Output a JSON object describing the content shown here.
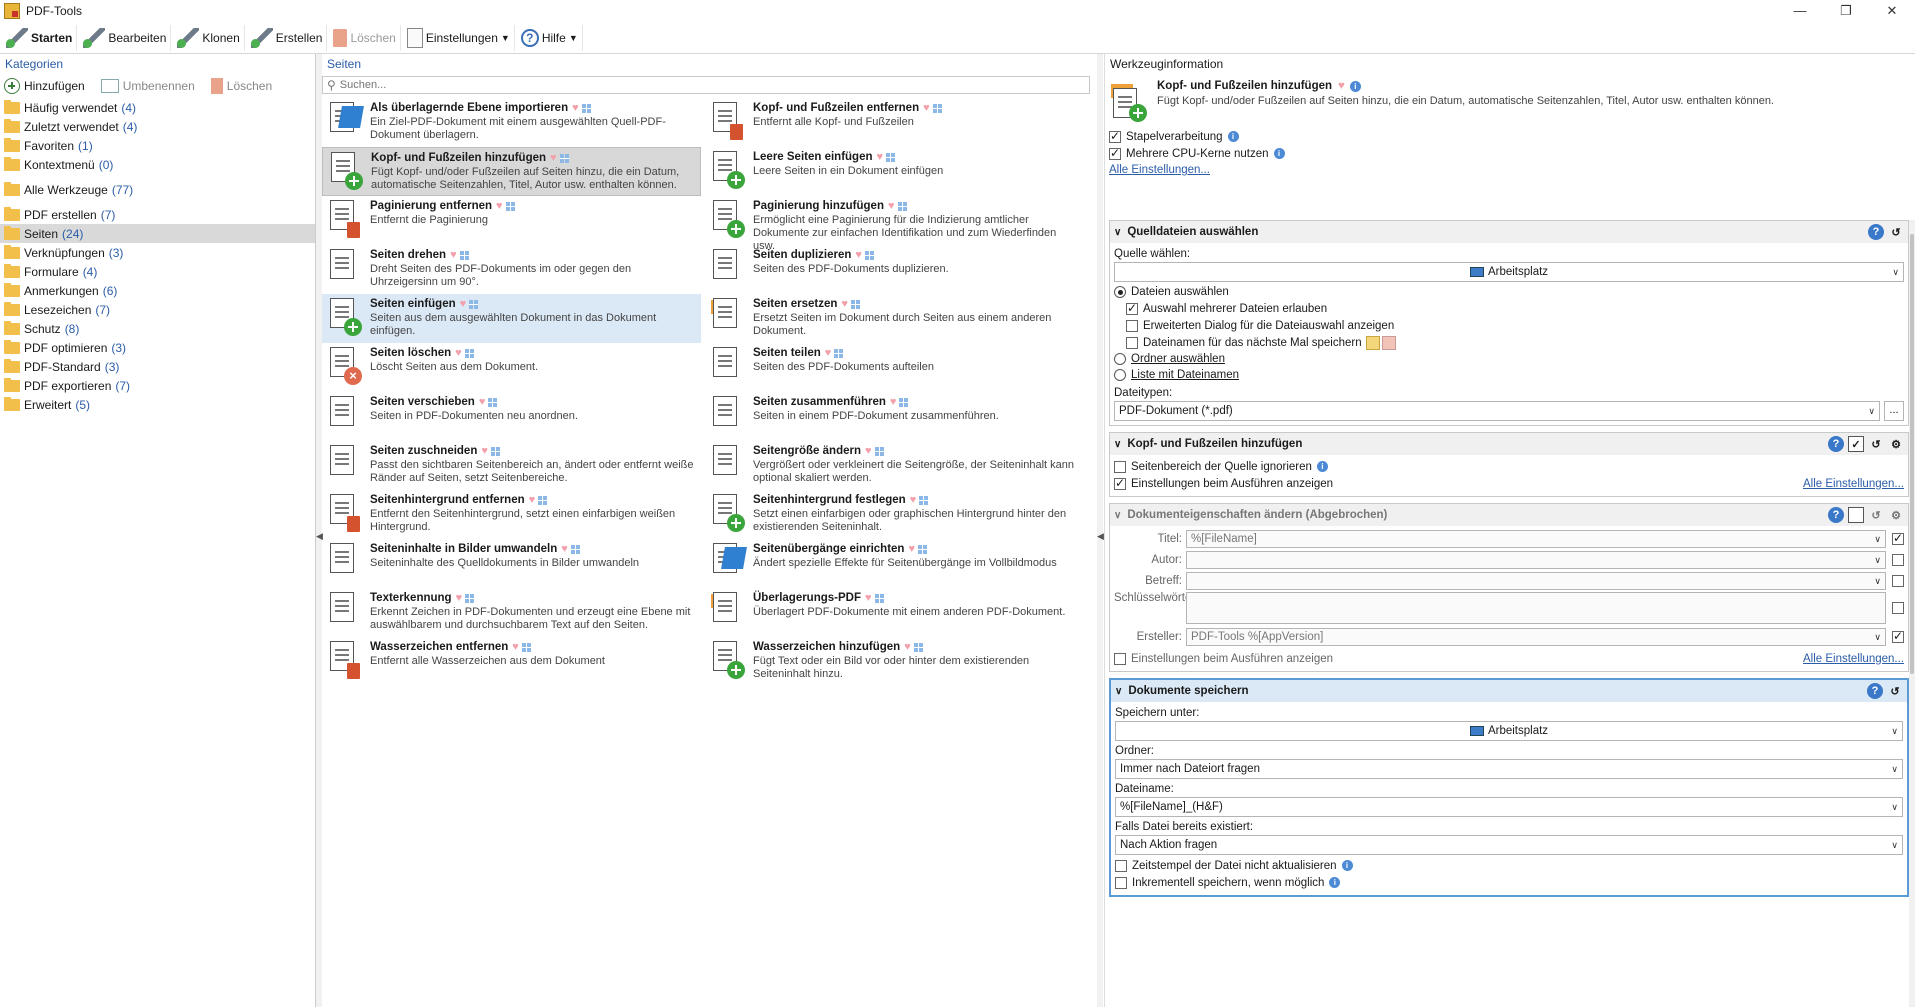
{
  "window": {
    "title": "PDF-Tools"
  },
  "toolbar": {
    "items": [
      {
        "label": "Starten",
        "bold": true,
        "disabled": false
      },
      {
        "label": "Bearbeiten",
        "disabled": false
      },
      {
        "label": "Klonen",
        "disabled": false
      },
      {
        "label": "Erstellen",
        "disabled": false
      },
      {
        "label": "Löschen",
        "disabled": true
      },
      {
        "label": "Einstellungen",
        "disabled": false,
        "dropdown": true
      },
      {
        "label": "Hilfe",
        "disabled": false,
        "dropdown": true
      }
    ]
  },
  "categories": {
    "header": "Kategorien",
    "actions": {
      "add": "Hinzufügen",
      "rename": "Umbenennen",
      "delete": "Löschen"
    },
    "items": [
      {
        "label": "Häufig verwendet",
        "count": "(4)"
      },
      {
        "label": "Zuletzt verwendet",
        "count": "(4)"
      },
      {
        "label": "Favoriten",
        "count": "(1)"
      },
      {
        "label": "Kontextmenü",
        "count": "(0)"
      },
      {
        "label": "Alle Werkzeuge",
        "count": "(77)"
      },
      {
        "label": "PDF erstellen",
        "count": "(7)"
      },
      {
        "label": "Seiten",
        "count": "(24)"
      },
      {
        "label": "Verknüpfungen",
        "count": "(3)"
      },
      {
        "label": "Formulare",
        "count": "(4)"
      },
      {
        "label": "Anmerkungen",
        "count": "(6)"
      },
      {
        "label": "Lesezeichen",
        "count": "(7)"
      },
      {
        "label": "Schutz",
        "count": "(8)"
      },
      {
        "label": "PDF optimieren",
        "count": "(3)"
      },
      {
        "label": "PDF-Standard",
        "count": "(3)"
      },
      {
        "label": "PDF exportieren",
        "count": "(7)"
      },
      {
        "label": "Erweitert",
        "count": "(5)"
      }
    ],
    "selected": "Seiten"
  },
  "pages": {
    "header": "Seiten",
    "search_placeholder": "Suchen...",
    "tools": [
      {
        "name": "Als überlagernde Ebene importieren",
        "desc": "Ein Ziel-PDF-Dokument mit einem ausgewählten Quell-PDF-Dokument überlagern.",
        "icon": "layer-import-icon"
      },
      {
        "name": "Kopf- und Fußzeilen entfernen",
        "desc": "Entfernt alle Kopf- und Fußzeilen",
        "icon": "header-footer-remove-icon"
      },
      {
        "name": "Kopf- und Fußzeilen hinzufügen",
        "desc": "Fügt Kopf- und/oder Fußzeilen auf Seiten hinzu, die ein Datum, automatische Seitenzahlen, Titel, Autor usw. enthalten können.",
        "icon": "header-footer-add-icon"
      },
      {
        "name": "Leere Seiten einfügen",
        "desc": "Leere Seiten in ein Dokument einfügen",
        "icon": "blank-page-add-icon"
      },
      {
        "name": "Paginierung entfernen",
        "desc": "Entfernt die Paginierung",
        "icon": "pagination-remove-icon"
      },
      {
        "name": "Paginierung hinzufügen",
        "desc": "Ermöglicht eine Paginierung für die Indizierung amtlicher Dokumente zur einfachen Identifikation und zum Wiederfinden usw.",
        "icon": "pagination-add-icon"
      },
      {
        "name": "Seiten drehen",
        "desc": "Dreht Seiten des PDF-Dokuments im oder gegen den Uhrzeigersinn um 90°.",
        "icon": "rotate-90-icon"
      },
      {
        "name": "Seiten duplizieren",
        "desc": "Seiten des PDF-Dokuments duplizieren.",
        "icon": "duplicate-pages-icon"
      },
      {
        "name": "Seiten einfügen",
        "desc": "Seiten aus dem ausgewählten Dokument in das Dokument einfügen.",
        "icon": "insert-pages-icon"
      },
      {
        "name": "Seiten ersetzen",
        "desc": "Ersetzt Seiten im Dokument durch Seiten aus einem anderen Dokument.",
        "icon": "replace-pages-icon"
      },
      {
        "name": "Seiten löschen",
        "desc": "Löscht Seiten aus dem Dokument.",
        "icon": "delete-pages-icon"
      },
      {
        "name": "Seiten teilen",
        "desc": "Seiten des PDF-Dokuments aufteilen",
        "icon": "split-pages-icon"
      },
      {
        "name": "Seiten verschieben",
        "desc": "Seiten in PDF-Dokumenten neu anordnen.",
        "icon": "move-pages-icon"
      },
      {
        "name": "Seiten zusammenführen",
        "desc": "Seiten in einem PDF-Dokument zusammenführen.",
        "icon": "merge-pages-icon"
      },
      {
        "name": "Seiten zuschneiden",
        "desc": "Passt den sichtbaren Seitenbereich an, ändert oder entfernt weiße Ränder auf Seiten, setzt Seitenbereiche.",
        "icon": "crop-pages-icon"
      },
      {
        "name": "Seitengröße ändern",
        "desc": "Vergrößert oder verkleinert die Seitengröße, der Seiteninhalt kann optional skaliert werden.",
        "icon": "resize-page-icon"
      },
      {
        "name": "Seitenhintergrund entfernen",
        "desc": "Entfernt den Seitenhintergrund, setzt einen einfarbigen weißen Hintergrund.",
        "icon": "background-remove-icon"
      },
      {
        "name": "Seitenhintergrund festlegen",
        "desc": "Setzt einen einfarbigen oder graphischen Hintergrund hinter den existierenden Seiteninhalt.",
        "icon": "background-set-icon"
      },
      {
        "name": "Seiteninhalte in Bilder umwandeln",
        "desc": "Seiteninhalte des Quelldokuments in Bilder umwandeln",
        "icon": "page-to-image-icon"
      },
      {
        "name": "Seitenübergänge einrichten",
        "desc": "Ändert spezielle Effekte für Seitenübergänge im Vollbildmodus",
        "icon": "page-transition-icon"
      },
      {
        "name": "Texterkennung",
        "desc": "Erkennt Zeichen in PDF-Dokumenten und erzeugt eine Ebene mit auswählbarem und durchsuchbarem Text auf den Seiten.",
        "icon": "ocr-icon"
      },
      {
        "name": "Überlagerungs-PDF",
        "desc": "Überlagert PDF-Dokumente mit einem anderen PDF-Dokument.",
        "icon": "overlay-pdf-icon"
      },
      {
        "name": "Wasserzeichen entfernen",
        "desc": "Entfernt alle Wasserzeichen aus dem Dokument",
        "icon": "watermark-remove-icon"
      },
      {
        "name": "Wasserzeichen hinzufügen",
        "desc": "Fügt Text oder ein Bild vor oder hinter dem existierenden Seiteninhalt hinzu.",
        "icon": "watermark-add-icon"
      }
    ],
    "selected_index": 2,
    "hover_index": 8
  },
  "info": {
    "header": "Werkzeuginformation",
    "tool_name": "Kopf- und Fußzeilen hinzufügen",
    "tool_desc": "Fügt Kopf- und/oder Fußzeilen auf Seiten hinzu, die ein Datum, automatische Seitenzahlen, Titel, Autor usw. enthalten können.",
    "batch": "Stapelverarbeitung",
    "multicore": "Mehrere CPU-Kerne nutzen",
    "all_settings": "Alle Einstellungen...",
    "source": {
      "title": "Quelldateien auswählen",
      "source_label": "Quelle wählen:",
      "source_value": "Arbeitsplatz",
      "opt_files": "Dateien auswählen",
      "opt_multi": "Auswahl mehrerer Dateien erlauben",
      "opt_ext_dialog": "Erweiterten Dialog für die Dateiauswahl anzeigen",
      "opt_save_names": "Dateinamen für das nächste Mal speichern",
      "opt_folder": "Ordner auswählen",
      "opt_list": "Liste mit Dateinamen",
      "filetypes_label": "Dateitypen:",
      "filetypes_value": "PDF-Dokument (*.pdf)",
      "dots": "..."
    },
    "hf": {
      "title": "Kopf- und Fußzeilen hinzufügen",
      "ignore_range": "Seitenbereich der Quelle ignorieren",
      "show_settings": "Einstellungen beim Ausführen anzeigen",
      "all_settings": "Alle Einstellungen..."
    },
    "props": {
      "title": "Dokumenteigenschaften ändern (Abgebrochen)",
      "title_label": "Titel:",
      "title_value": "%[FileName]",
      "author_label": "Autor:",
      "subject_label": "Betreff:",
      "keywords_label": "Schlüsselwörter:",
      "creator_label": "Ersteller:",
      "creator_value": "PDF-Tools %[AppVersion]",
      "show_settings": "Einstellungen beim Ausführen anzeigen",
      "all_settings": "Alle Einstellungen..."
    },
    "save": {
      "title": "Dokumente speichern",
      "save_under_label": "Speichern unter:",
      "save_under_value": "Arbeitsplatz",
      "folder_label": "Ordner:",
      "folder_value": "Immer nach Dateiort fragen",
      "filename_label": "Dateiname:",
      "filename_value": "%[FileName]_(H&F)",
      "exists_label": "Falls Datei bereits existiert:",
      "exists_value": "Nach Aktion fragen",
      "no_timestamp": "Zeitstempel der Datei nicht aktualisieren",
      "incremental": "Inkrementell speichern, wenn möglich"
    }
  }
}
